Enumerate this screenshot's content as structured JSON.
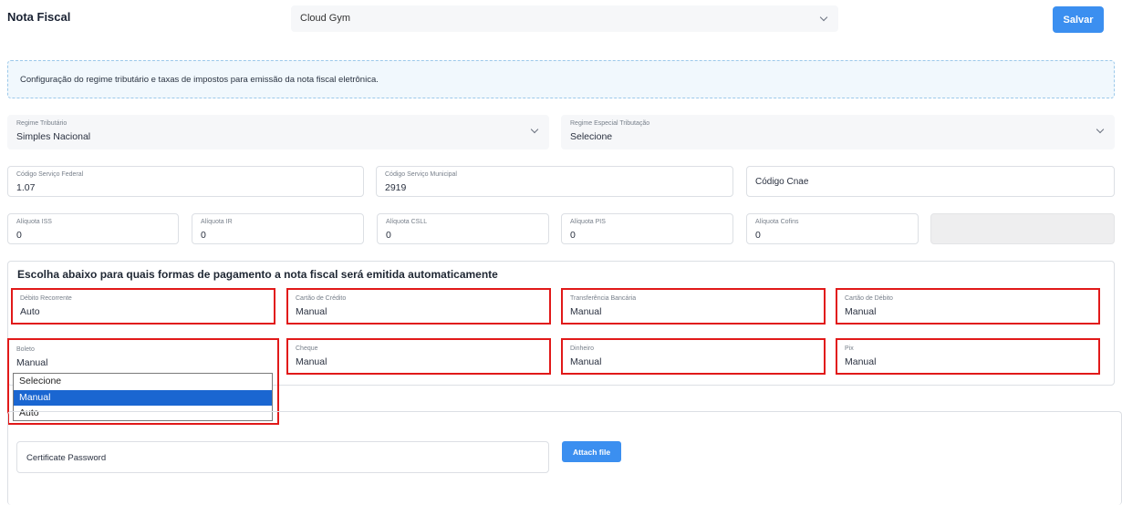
{
  "header": {
    "title": "Nota Fiscal",
    "company_select": "Cloud Gym",
    "save_label": "Salvar"
  },
  "info_text": "Configuração do regime tributário e taxas de impostos para emissão da nota fiscal eletrônica.",
  "regime": {
    "tributario": {
      "label": "Regime Tributário",
      "value": "Simples Nacional"
    },
    "especial": {
      "label": "Regime Especial Tributação",
      "value": "Selecione"
    }
  },
  "codigos": {
    "federal": {
      "label": "Código Serviço Federal",
      "value": "1.07"
    },
    "municipal": {
      "label": "Código Serviço Municipal",
      "value": "2919"
    },
    "cnae": {
      "placeholder": "Código Cnae"
    }
  },
  "aliquotas": [
    {
      "label": "Alíquota ISS",
      "value": "0"
    },
    {
      "label": "Alíquota IR",
      "value": "0"
    },
    {
      "label": "Alíquota CSLL",
      "value": "0"
    },
    {
      "label": "Alíquota PIS",
      "value": "0"
    },
    {
      "label": "Alíquota Cofins",
      "value": "0"
    }
  ],
  "pagamento": {
    "title": "Escolha abaixo para quais formas de pagamento a nota fiscal será emitida automaticamente",
    "items": [
      {
        "label": "Débito Recorrente",
        "value": "Auto"
      },
      {
        "label": "Cartão de Crédito",
        "value": "Manual"
      },
      {
        "label": "Transferência Bancária",
        "value": "Manual"
      },
      {
        "label": "Cartão de Débito",
        "value": "Manual"
      },
      {
        "label": "Boleto",
        "value": "Manual"
      },
      {
        "label": "Cheque",
        "value": "Manual"
      },
      {
        "label": "Dinheiro",
        "value": "Manual"
      },
      {
        "label": "Pix",
        "value": "Manual"
      }
    ],
    "dropdown_options": [
      "Selecione",
      "Manual",
      "Auto"
    ],
    "dropdown_selected": "Manual"
  },
  "certificate": {
    "password_placeholder": "Certificate Password",
    "attach_label": "Attach file"
  },
  "colors": {
    "accent": "#3b8ff0",
    "highlight": "#e11919",
    "selected_option": "#1a66d1"
  }
}
